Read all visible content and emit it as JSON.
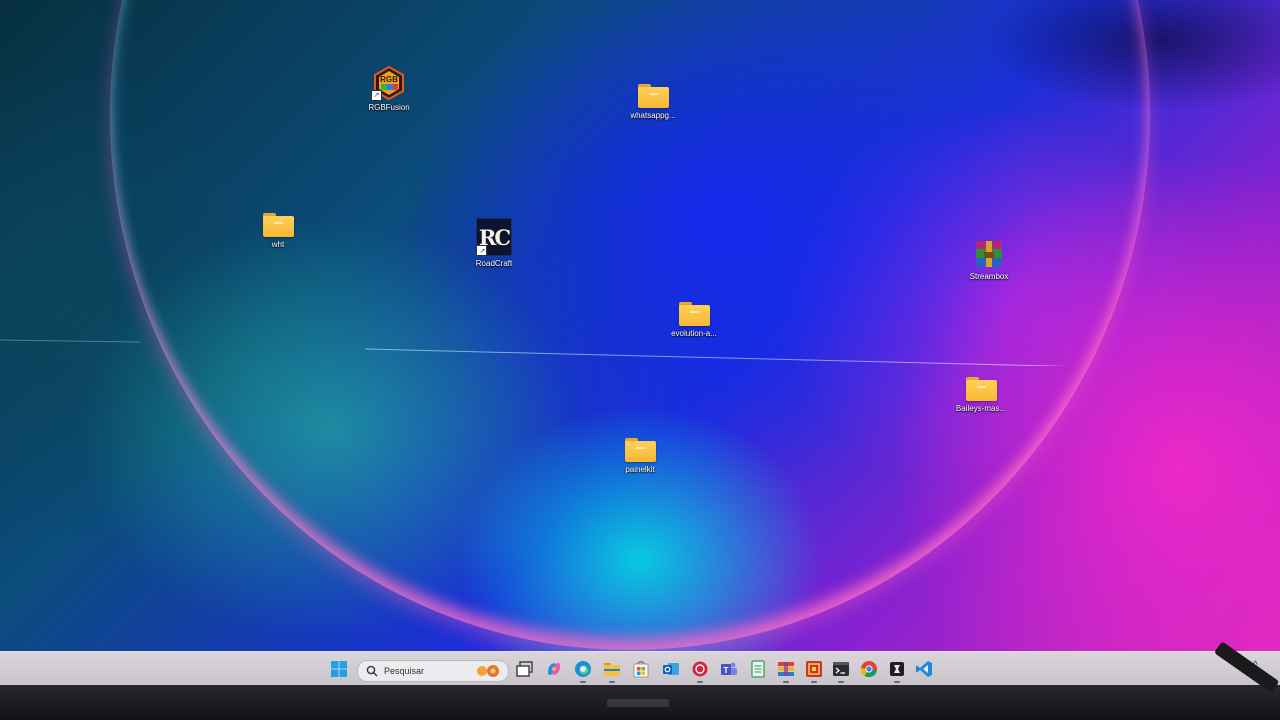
{
  "desktop": {
    "icons": [
      {
        "label": "RGBFusion",
        "type": "app",
        "icon": "rgbfusion-icon",
        "badge_text": "RGB"
      },
      {
        "label": "whatsappg...",
        "type": "folder",
        "icon": "folder-icon"
      },
      {
        "label": "wht",
        "type": "folder",
        "icon": "folder-icon"
      },
      {
        "label": "RoadCraft",
        "type": "app",
        "icon": "roadcraft-icon",
        "badge_text": "RC"
      },
      {
        "label": "Streambox",
        "type": "app",
        "icon": "winrar-archive-icon"
      },
      {
        "label": "evolution-a...",
        "type": "folder",
        "icon": "folder-icon"
      },
      {
        "label": "Baileys-mas...",
        "type": "folder",
        "icon": "folder-icon"
      },
      {
        "label": "painelkit",
        "type": "folder",
        "icon": "folder-icon"
      }
    ]
  },
  "taskbar": {
    "start_icon": "windows-start-icon",
    "search": {
      "placeholder": "Pesquisar",
      "icon": "search-icon"
    },
    "apps": [
      {
        "name": "task-view",
        "icon": "task-view-icon"
      },
      {
        "name": "copilot",
        "icon": "copilot-icon"
      },
      {
        "name": "edge",
        "icon": "edge-icon"
      },
      {
        "name": "file-explorer",
        "icon": "file-explorer-icon"
      },
      {
        "name": "store",
        "icon": "store-icon"
      },
      {
        "name": "outlook",
        "icon": "outlook-icon"
      },
      {
        "name": "app-red",
        "icon": "red-circle-app-icon"
      },
      {
        "name": "teams",
        "icon": "teams-icon"
      },
      {
        "name": "notepad",
        "icon": "notepad-icon"
      },
      {
        "name": "app-grid",
        "icon": "colorful-grid-app-icon"
      },
      {
        "name": "winrar",
        "icon": "winrar-icon"
      },
      {
        "name": "terminal",
        "icon": "terminal-icon"
      },
      {
        "name": "chrome",
        "icon": "chrome-icon"
      },
      {
        "name": "app-dark",
        "icon": "dark-square-app-icon"
      },
      {
        "name": "vscode",
        "icon": "vscode-icon"
      }
    ],
    "tray_chevron": "^"
  },
  "colors": {
    "taskbar_bg": "#d5d1d7",
    "folder_yellow": "#f7b734",
    "wallpaper_blue": "#1b2fd8",
    "wallpaper_magenta": "#e62ab6",
    "wallpaper_cyan": "#00e6e1"
  }
}
